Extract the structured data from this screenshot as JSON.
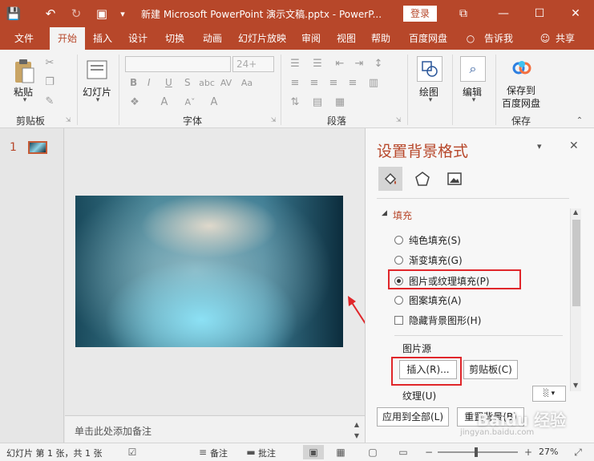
{
  "colors": {
    "accent": "#b7472a",
    "highlight": "#e0262a",
    "arrow": "#e0262a"
  },
  "titlebar": {
    "title": "新建 Microsoft PowerPoint 演示文稿.pptx  -  PowerP...",
    "login": "登录"
  },
  "tabs": [
    "文件",
    "开始",
    "插入",
    "设计",
    "切换",
    "动画",
    "幻灯片放映",
    "审阅",
    "视图",
    "帮助",
    "百度网盘"
  ],
  "tell_me": "告诉我",
  "share": "共享",
  "ribbon": {
    "paste": "粘贴",
    "new_slide": "幻灯片",
    "font_size": "24+",
    "draw": "绘图",
    "edit": "编辑",
    "save_baidu": [
      "保存到",
      "百度网盘"
    ],
    "groups": {
      "clipboard": "剪贴板",
      "font": "字体",
      "paragraph": "段落",
      "save": "保存"
    },
    "font_buttons": [
      "B",
      "I",
      "U",
      "S"
    ]
  },
  "thumbs": {
    "number": "1"
  },
  "notes": {
    "placeholder": "单击此处添加备注"
  },
  "format_pane": {
    "title": "设置背景格式",
    "section": "填充",
    "options": [
      {
        "label": "纯色填充(S)",
        "selected": false
      },
      {
        "label": "渐变填充(G)",
        "selected": false
      },
      {
        "label": "图片或纹理填充(P)",
        "selected": true
      },
      {
        "label": "图案填充(A)",
        "selected": false
      }
    ],
    "hide_graphics": "隐藏背景图形(H)",
    "picture_source": "图片源",
    "insert_button": "插入(R)...",
    "clipboard_button": "剪贴板(C)",
    "texture": "纹理(U)",
    "apply_all": "应用到全部(L)",
    "reset_bg": "重置背景(B)"
  },
  "status": {
    "slide_info": "幻灯片 第 1 张，共 1 张",
    "notes": "备注",
    "comments": "批注",
    "zoom": "27%"
  },
  "watermark": {
    "main": "Baidu 经验",
    "sub": "jingyan.baidu.com"
  }
}
